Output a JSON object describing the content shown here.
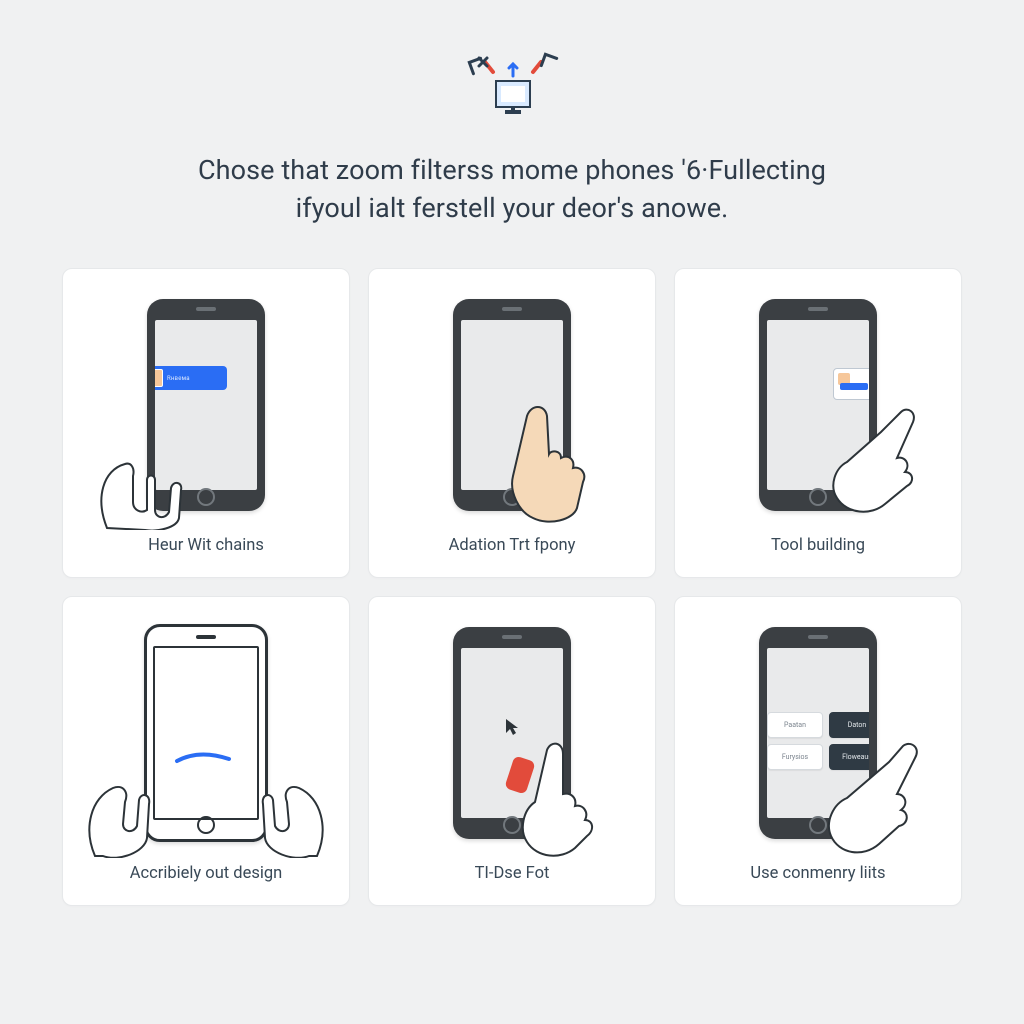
{
  "headline": {
    "line1": "Chose that zoom filterss mome phones '6·Fullecting",
    "line2": "ifyoul ialt ferstell your deor's anowe."
  },
  "cards": [
    {
      "label": "Heur Wit chains",
      "badge_text": "Rнвема"
    },
    {
      "label": "Adation Trt fpony"
    },
    {
      "label": "Tool building"
    },
    {
      "label": "Accribiely out design"
    },
    {
      "label": "TI-Dse Fot"
    },
    {
      "label": "Use conmenry liits",
      "buttons": [
        "Paatan",
        "Daton",
        "Furysios",
        "Floweaus"
      ]
    }
  ],
  "colors": {
    "accent_blue": "#2a6df4",
    "accent_red": "#e24b3b",
    "ink": "#2c3e50"
  }
}
